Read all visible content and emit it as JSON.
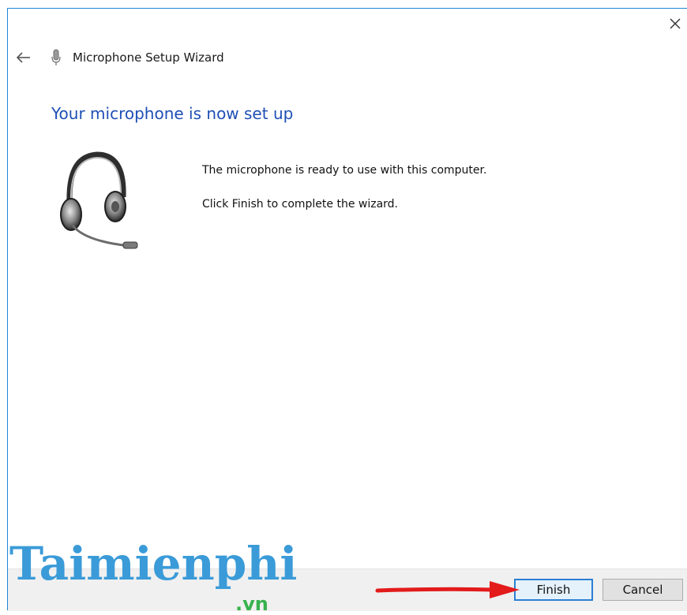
{
  "window": {
    "title": "Microphone Setup Wizard",
    "close_icon": "close-icon",
    "back_icon": "back-arrow-icon",
    "app_icon": "microphone-icon"
  },
  "main": {
    "heading": "Your microphone is now set up",
    "illustration": "headset-image",
    "message_ready": "The microphone is ready to use with this computer.",
    "message_finish": "Click Finish to complete the wizard."
  },
  "footer": {
    "finish_label": "Finish",
    "cancel_label": "Cancel"
  },
  "annotation": {
    "arrow": "red-arrow-pointing-to-finish",
    "color": "#e31b1b"
  },
  "watermark": {
    "brand": "Taimienphi",
    "suffix": ".vn"
  },
  "colors": {
    "heading": "#1f4fb5",
    "accent_border": "#1e86d6",
    "watermark": "#3a9bd8"
  }
}
